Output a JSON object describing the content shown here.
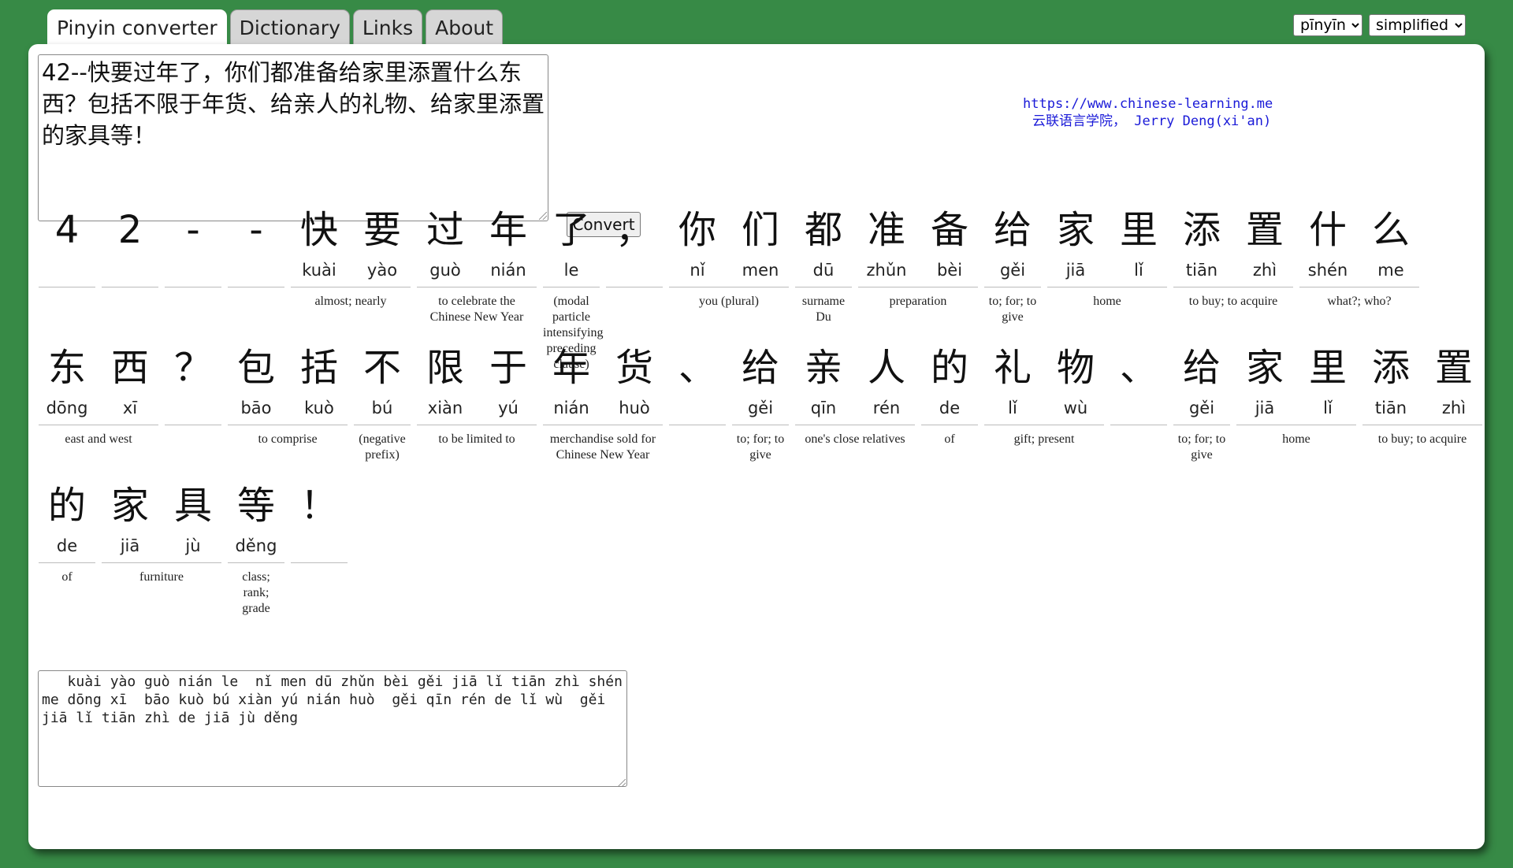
{
  "tabs": [
    {
      "label": "Pinyin converter",
      "active": true
    },
    {
      "label": "Dictionary",
      "active": false
    },
    {
      "label": "Links",
      "active": false
    },
    {
      "label": "About",
      "active": false
    }
  ],
  "selects": {
    "script_style": "pīnyīn",
    "charset": "simplified"
  },
  "input_text": "42--快要过年了，你们都准备给家里添置什么东西？包括不限于年货、给亲人的礼物、给家里添置的家具等！",
  "convert_label": "Convert",
  "credits": {
    "url": "https://www.chinese-learning.me",
    "author": "云联语言学院， Jerry Deng(xi'an)"
  },
  "rows": [
    [
      {
        "chars": [
          [
            "4",
            ""
          ]
        ],
        "def": ""
      },
      {
        "chars": [
          [
            "2",
            ""
          ]
        ],
        "def": ""
      },
      {
        "chars": [
          [
            "-",
            ""
          ]
        ],
        "def": ""
      },
      {
        "chars": [
          [
            "-",
            ""
          ]
        ],
        "def": ""
      },
      {
        "chars": [
          [
            "快",
            "kuài"
          ],
          [
            "要",
            "yào"
          ]
        ],
        "def": "almost; nearly"
      },
      {
        "chars": [
          [
            "过",
            "guò"
          ],
          [
            "年",
            "nián"
          ]
        ],
        "def": "to celebrate the Chinese New Year"
      },
      {
        "chars": [
          [
            "了",
            "le"
          ]
        ],
        "def": "(modal particle intensifying preceding clause)"
      },
      {
        "chars": [
          [
            "，",
            ""
          ]
        ],
        "def": ""
      },
      {
        "chars": [
          [
            "你",
            "nǐ"
          ],
          [
            "们",
            "men"
          ]
        ],
        "def": "you (plural)"
      },
      {
        "chars": [
          [
            "都",
            "dū"
          ]
        ],
        "def": "surname Du"
      },
      {
        "chars": [
          [
            "准",
            "zhǔn"
          ],
          [
            "备",
            "bèi"
          ]
        ],
        "def": "preparation"
      },
      {
        "chars": [
          [
            "给",
            "gěi"
          ]
        ],
        "def": "to; for; to give"
      },
      {
        "chars": [
          [
            "家",
            "jiā"
          ],
          [
            "里",
            "lǐ"
          ]
        ],
        "def": "home"
      },
      {
        "chars": [
          [
            "添",
            "tiān"
          ],
          [
            "置",
            "zhì"
          ]
        ],
        "def": "to buy; to acquire"
      },
      {
        "chars": [
          [
            "什",
            "shén"
          ],
          [
            "么",
            "me"
          ]
        ],
        "def": "what?; who?"
      }
    ],
    [
      {
        "chars": [
          [
            "东",
            "dōng"
          ],
          [
            "西",
            "xī"
          ]
        ],
        "def": "east and west"
      },
      {
        "chars": [
          [
            "？",
            ""
          ]
        ],
        "def": ""
      },
      {
        "chars": [
          [
            "包",
            "bāo"
          ],
          [
            "括",
            "kuò"
          ]
        ],
        "def": "to comprise"
      },
      {
        "chars": [
          [
            "不",
            "bú"
          ]
        ],
        "def": "(negative prefix)"
      },
      {
        "chars": [
          [
            "限",
            "xiàn"
          ],
          [
            "于",
            "yú"
          ]
        ],
        "def": "to be limited to"
      },
      {
        "chars": [
          [
            "年",
            "nián"
          ],
          [
            "货",
            "huò"
          ]
        ],
        "def": "merchandise sold for Chinese New Year"
      },
      {
        "chars": [
          [
            "、",
            ""
          ]
        ],
        "def": ""
      },
      {
        "chars": [
          [
            "给",
            "gěi"
          ]
        ],
        "def": "to; for; to give"
      },
      {
        "chars": [
          [
            "亲",
            "qīn"
          ],
          [
            "人",
            "rén"
          ]
        ],
        "def": "one's close relatives"
      },
      {
        "chars": [
          [
            "的",
            "de"
          ]
        ],
        "def": "of"
      },
      {
        "chars": [
          [
            "礼",
            "lǐ"
          ],
          [
            "物",
            "wù"
          ]
        ],
        "def": "gift; present"
      },
      {
        "chars": [
          [
            "、",
            ""
          ]
        ],
        "def": ""
      },
      {
        "chars": [
          [
            "给",
            "gěi"
          ]
        ],
        "def": "to; for; to give"
      },
      {
        "chars": [
          [
            "家",
            "jiā"
          ],
          [
            "里",
            "lǐ"
          ]
        ],
        "def": "home"
      },
      {
        "chars": [
          [
            "添",
            "tiān"
          ],
          [
            "置",
            "zhì"
          ]
        ],
        "def": "to buy; to acquire"
      }
    ],
    [
      {
        "chars": [
          [
            "的",
            "de"
          ]
        ],
        "def": "of"
      },
      {
        "chars": [
          [
            "家",
            "jiā"
          ],
          [
            "具",
            "jù"
          ]
        ],
        "def": "furniture"
      },
      {
        "chars": [
          [
            "等",
            "děng"
          ]
        ],
        "def": "class; rank; grade"
      },
      {
        "chars": [
          [
            "！",
            ""
          ]
        ],
        "def": ""
      }
    ]
  ],
  "output_text": "   kuài yào guò nián le  nǐ men dū zhǔn bèi gěi jiā lǐ tiān zhì shén me dōng xī  bāo kuò bú xiàn yú nián huò  gěi qīn rén de lǐ wù  gěi jiā lǐ tiān zhì de jiā jù děng"
}
